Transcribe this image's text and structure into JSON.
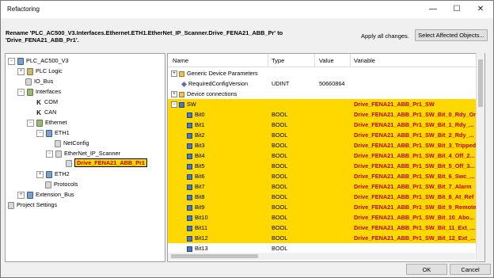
{
  "window": {
    "title": "Refactoring",
    "minimize": "—",
    "maximize": "☐",
    "close": "✕"
  },
  "header": {
    "rename_line1": "Rename 'PLC_AC500_V3.Interfaces.Ethernet.ETH1.EtherNet_IP_Scanner.Drive_FENA21_ABB_Pr' to",
    "rename_line2": "'Drive_FENA21_ABB_Pr1'.",
    "apply_all": "Apply all changes.",
    "select_affected": "Select Affected Objects..."
  },
  "tree": [
    {
      "label": "PLC_AC500_V3",
      "icon": "plc-icon"
    },
    {
      "label": "PLC Logic",
      "icon": "plc-logic-icon"
    },
    {
      "label": "IO_Bus",
      "icon": "io-bus-icon"
    },
    {
      "label": "Interfaces",
      "icon": "interfaces-icon"
    },
    {
      "label": "COM",
      "icon": "com-icon"
    },
    {
      "label": "CAN",
      "icon": "can-icon"
    },
    {
      "label": "Ethernet",
      "icon": "ethernet-icon"
    },
    {
      "label": "ETH1",
      "icon": "eth-icon"
    },
    {
      "label": "NetConfig",
      "icon": "config-icon"
    },
    {
      "label": "EtherNet_IP_Scanner",
      "icon": "scanner-icon"
    },
    {
      "label": "Drive_FENA21_ABB_Pr1",
      "icon": "drive-icon"
    },
    {
      "label": "ETH2",
      "icon": "eth-icon"
    },
    {
      "label": "Protocols",
      "icon": "protocols-icon"
    },
    {
      "label": "Extension_Bus",
      "icon": "extension-bus-icon"
    },
    {
      "label": "Project Settings",
      "icon": "settings-icon"
    }
  ],
  "grid": {
    "columns": [
      "Name",
      "Type",
      "Value",
      "Variable"
    ],
    "rows": [
      {
        "name": "Generic Device Parameters",
        "type": "",
        "value": "",
        "variable": ""
      },
      {
        "name": "RequiredConfigVersion",
        "type": "UDINT",
        "value": "50660864",
        "variable": ""
      },
      {
        "name": "Device connections",
        "type": "",
        "value": "",
        "variable": ""
      },
      {
        "name": "SW",
        "type": "",
        "value": "",
        "variable": "Drive_FENA21_ABB_Pr1_SW"
      },
      {
        "name": "Bit0",
        "type": "BOOL",
        "value": "",
        "variable": "Drive_FENA21_ABB_Pr1_SW_Bit_0_Rdy_On"
      },
      {
        "name": "Bit1",
        "type": "BOOL",
        "value": "",
        "variable": "Drive_FENA21_ABB_Pr1_SW_Bit_1_Rdy_..."
      },
      {
        "name": "Bit2",
        "type": "BOOL",
        "value": "",
        "variable": "Drive_FENA21_ABB_Pr1_SW_Bit_2_Rdy_..."
      },
      {
        "name": "Bit3",
        "type": "BOOL",
        "value": "",
        "variable": "Drive_FENA21_ABB_Pr1_SW_Bit_3_Tripped"
      },
      {
        "name": "Bit4",
        "type": "BOOL",
        "value": "",
        "variable": "Drive_FENA21_ABB_Pr1_SW_Bit_4_Off_2..."
      },
      {
        "name": "Bit5",
        "type": "BOOL",
        "value": "",
        "variable": "Drive_FENA21_ABB_Pr1_SW_Bit_5_Off_3..."
      },
      {
        "name": "Bit6",
        "type": "BOOL",
        "value": "",
        "variable": "Drive_FENA21_ABB_Pr1_SW_Bit_6_Swc_..."
      },
      {
        "name": "Bit7",
        "type": "BOOL",
        "value": "",
        "variable": "Drive_FENA21_ABB_Pr1_SW_Bit_7_Alarm"
      },
      {
        "name": "Bit8",
        "type": "BOOL",
        "value": "",
        "variable": "Drive_FENA21_ABB_Pr1_SW_Bit_8_At_Ref"
      },
      {
        "name": "Bit9",
        "type": "BOOL",
        "value": "",
        "variable": "Drive_FENA21_ABB_Pr1_SW_Bit_9_Remote"
      },
      {
        "name": "Bit10",
        "type": "BOOL",
        "value": "",
        "variable": "Drive_FENA21_ABB_Pr1_SW_Bit_10_Abo..."
      },
      {
        "name": "Bit11",
        "type": "BOOL",
        "value": "",
        "variable": "Drive_FENA21_ABB_Pr1_SW_Bit_11_Ext_..."
      },
      {
        "name": "Bit12",
        "type": "BOOL",
        "value": "",
        "variable": "Drive_FENA21_ABB_Pr1_SW_Bit_12_Ext_..."
      },
      {
        "name": "Bit13",
        "type": "BOOL",
        "value": "",
        "variable": ""
      }
    ]
  },
  "footer": {
    "ok": "OK",
    "cancel": "Cancel"
  },
  "colors": {
    "highlight": "#ffd800",
    "variable_text": "#c00000"
  }
}
